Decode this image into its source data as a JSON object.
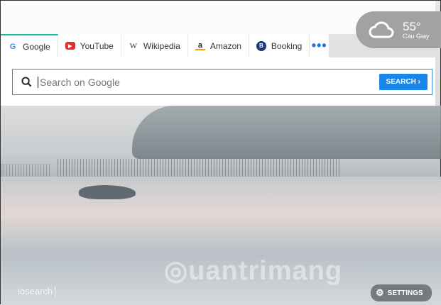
{
  "tabs": [
    {
      "label": "Google",
      "icon": "google-icon"
    },
    {
      "label": "YouTube",
      "icon": "youtube-icon"
    },
    {
      "label": "Wikipedia",
      "icon": "wikipedia-icon"
    },
    {
      "label": "Amazon",
      "icon": "amazon-icon"
    },
    {
      "label": "Booking",
      "icon": "booking-icon"
    }
  ],
  "more_label": "•••",
  "search": {
    "placeholder": "Search on Google",
    "button": "SEARCH ›"
  },
  "weather": {
    "temp": "55°",
    "location": "Cau Giay"
  },
  "brand": "iosearch",
  "settings_label": "SETTINGS",
  "watermark": "Quantrimang",
  "colors": {
    "accent": "#1a86e8",
    "active_tab": "#1abc9c"
  }
}
